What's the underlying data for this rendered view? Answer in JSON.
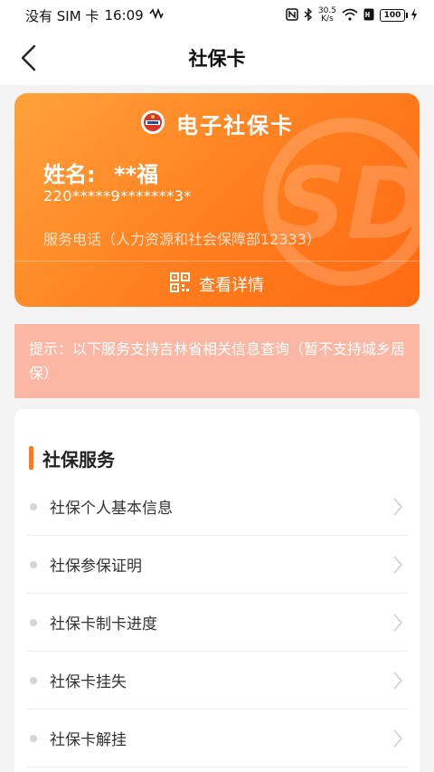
{
  "status_bar": {
    "carrier": "没有 SIM 卡",
    "time": "16:09",
    "net_speed_value": "30.5",
    "net_speed_unit": "K/s",
    "battery": "100"
  },
  "header": {
    "title": "社保卡"
  },
  "card": {
    "title": "电子社保卡",
    "name_label": "姓名:",
    "name_value": "**福",
    "id_number": "220*****9*******3*",
    "service_phone": "服务电话（人力资源和社会保障部12333）",
    "detail_label": "查看详情",
    "colors": {
      "start": "#ffa23a",
      "end": "#ff6a12"
    }
  },
  "notice": {
    "text": "提示：以下服务支持吉林省相关信息查询（暂不支持城乡居保）"
  },
  "services": {
    "title": "社保服务",
    "accent": "#ff7a1a",
    "items": [
      {
        "label": "社保个人基本信息"
      },
      {
        "label": "社保参保证明"
      },
      {
        "label": "社保卡制卡进度"
      },
      {
        "label": "社保卡挂失"
      },
      {
        "label": "社保卡解挂"
      }
    ]
  }
}
